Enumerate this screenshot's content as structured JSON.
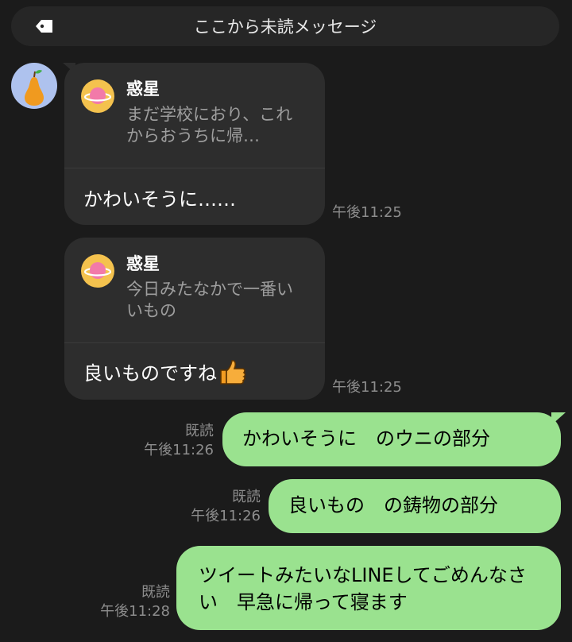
{
  "banner": {
    "label": "ここから未読メッセージ"
  },
  "incoming": [
    {
      "quote_name": "惑星",
      "quote_text": "まだ学校におり、これからおうちに帰…",
      "reply": "かわいそうに……",
      "time": "午後11:25"
    },
    {
      "quote_name": "惑星",
      "quote_text": "今日みたなかで一番いいもの",
      "reply": "良いものですね",
      "time": "午後11:25"
    }
  ],
  "outgoing": [
    {
      "text": "かわいそうに　のウニの部分",
      "read": "既読",
      "time": "午後11:26"
    },
    {
      "text": "良いもの　の鋳物の部分",
      "read": "既読",
      "time": "午後11:26"
    },
    {
      "text": "ツイートみたいなLINEしてごめんなさい　早急に帰って寝ます",
      "read": "既読",
      "time": "午後11:28"
    }
  ],
  "icons": {
    "banner": "tag-icon",
    "sender_avatar": "pear-icon",
    "quote_avatar": "planet-icon",
    "emoji": "thumbs-up-icon"
  },
  "colors": {
    "background": "#1b1b1b",
    "incoming_bubble": "#2d2d2d",
    "outgoing_bubble": "#9ae28f",
    "meta_text": "#8d8d8d"
  }
}
